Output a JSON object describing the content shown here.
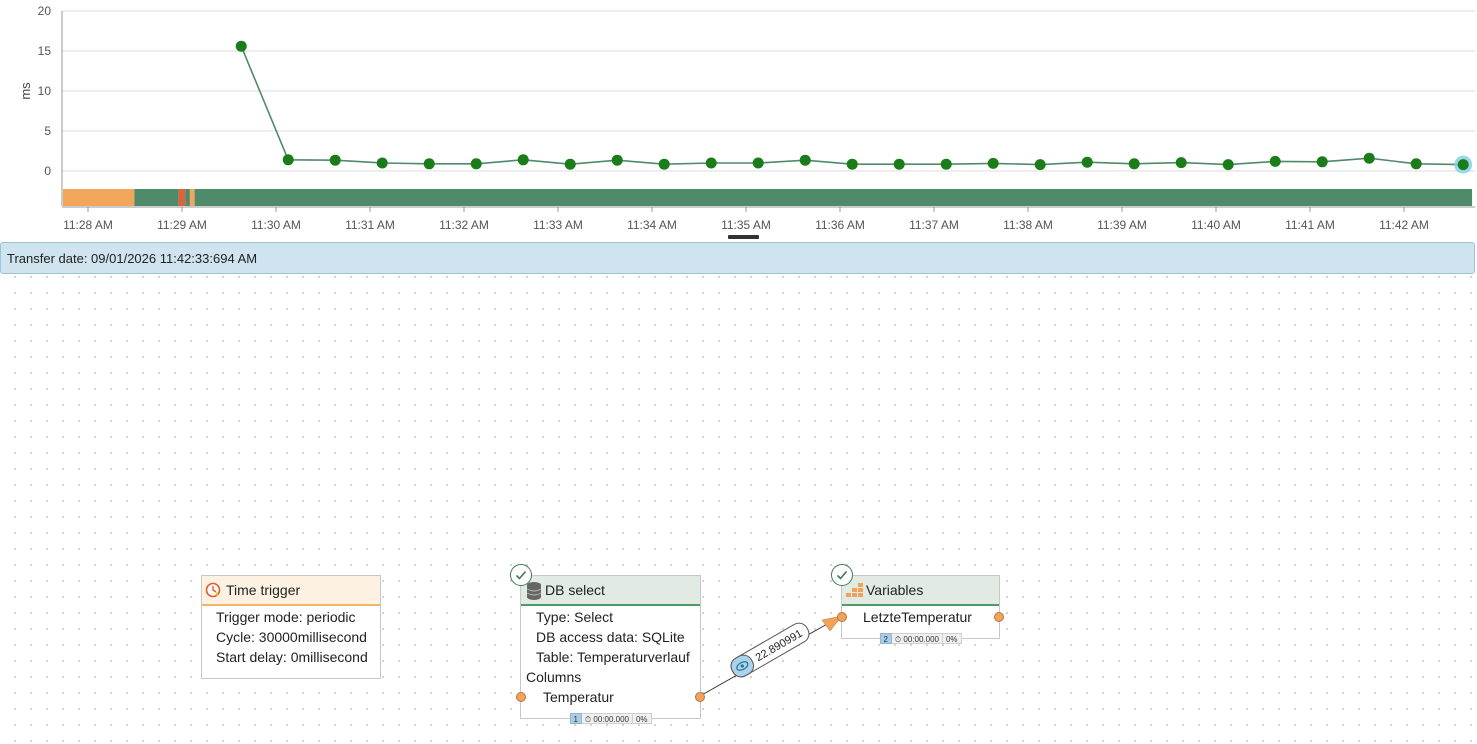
{
  "chart_data": {
    "type": "line",
    "ylabel": "ms",
    "ylim": [
      0,
      20
    ],
    "y_ticks": [
      "20",
      "15",
      "10",
      "5",
      "0"
    ],
    "x_ticks": [
      "11:28 AM",
      "11:29 AM",
      "11:30 AM",
      "11:31 AM",
      "11:32 AM",
      "11:33 AM",
      "11:34 AM",
      "11:35 AM",
      "11:36 AM",
      "11:37 AM",
      "11:38 AM",
      "11:39 AM",
      "11:40 AM",
      "11:41 AM",
      "11:42 AM"
    ],
    "x_minutes_from_1128": [
      1.63,
      2.13,
      2.63,
      3.13,
      3.63,
      4.13,
      4.63,
      5.13,
      5.63,
      6.13,
      6.63,
      7.13,
      7.63,
      8.13,
      8.63,
      9.13,
      9.63,
      10.13,
      10.63,
      11.13,
      11.63,
      12.13,
      12.63,
      13.13,
      13.63,
      14.13,
      14.63
    ],
    "values": [
      15.6,
      1.4,
      1.35,
      1.0,
      0.9,
      0.9,
      1.4,
      0.85,
      1.35,
      0.85,
      1.0,
      1.0,
      1.35,
      0.85,
      0.85,
      0.85,
      0.95,
      0.8,
      1.1,
      0.9,
      1.05,
      0.8,
      1.2,
      1.15,
      1.6,
      0.9,
      0.8
    ],
    "status_strip": [
      {
        "from": 0.0,
        "to": 0.76,
        "color": "#f2a65a"
      },
      {
        "from": 0.76,
        "to": 1.23,
        "color": "#4f8a6a"
      },
      {
        "from": 1.23,
        "to": 1.3,
        "color": "#e0623a"
      },
      {
        "from": 1.3,
        "to": 1.35,
        "color": "#4f8a6a"
      },
      {
        "from": 1.35,
        "to": 1.4,
        "color": "#f2a65a"
      },
      {
        "from": 1.4,
        "to": 14.99,
        "color": "#4f8a6a"
      }
    ],
    "grid": true,
    "line_color": "#4f8a6a",
    "point_color": "#1a7d1a",
    "selected_point_color": "#7fd0e6"
  },
  "transfer": {
    "text": "Transfer date: 09/01/2026 11:42:33:694 AM"
  },
  "nodes": {
    "time_trigger": {
      "title": "Time trigger",
      "rows": [
        "Trigger mode: periodic",
        "Cycle: 30000millisecond",
        "Start delay: 0millisecond"
      ]
    },
    "db_select": {
      "title": "DB select",
      "rows": [
        "Type: Select",
        "DB access data: SQLite",
        "Table: Temperaturverlauf"
      ],
      "columns_label": "Columns",
      "column": "Temperatur",
      "footer": {
        "count": "1",
        "time": "00:00.000",
        "percent": "0%"
      }
    },
    "variables": {
      "title": "Variables",
      "variable": "LetzteTemperatur",
      "footer": {
        "count": "2",
        "time": "00:00.000",
        "percent": "0%"
      }
    }
  },
  "edge": {
    "value_label": "22.890991"
  },
  "colors": {
    "accent_orange": "#f2a25b",
    "status_green": "#3d7a50",
    "transfer_bg": "#cfe4ef"
  },
  "icons": [
    "clock-trigger-icon",
    "database-icon",
    "variables-grid-icon",
    "check-circle-icon",
    "eye-icon",
    "stopwatch-icon"
  ]
}
